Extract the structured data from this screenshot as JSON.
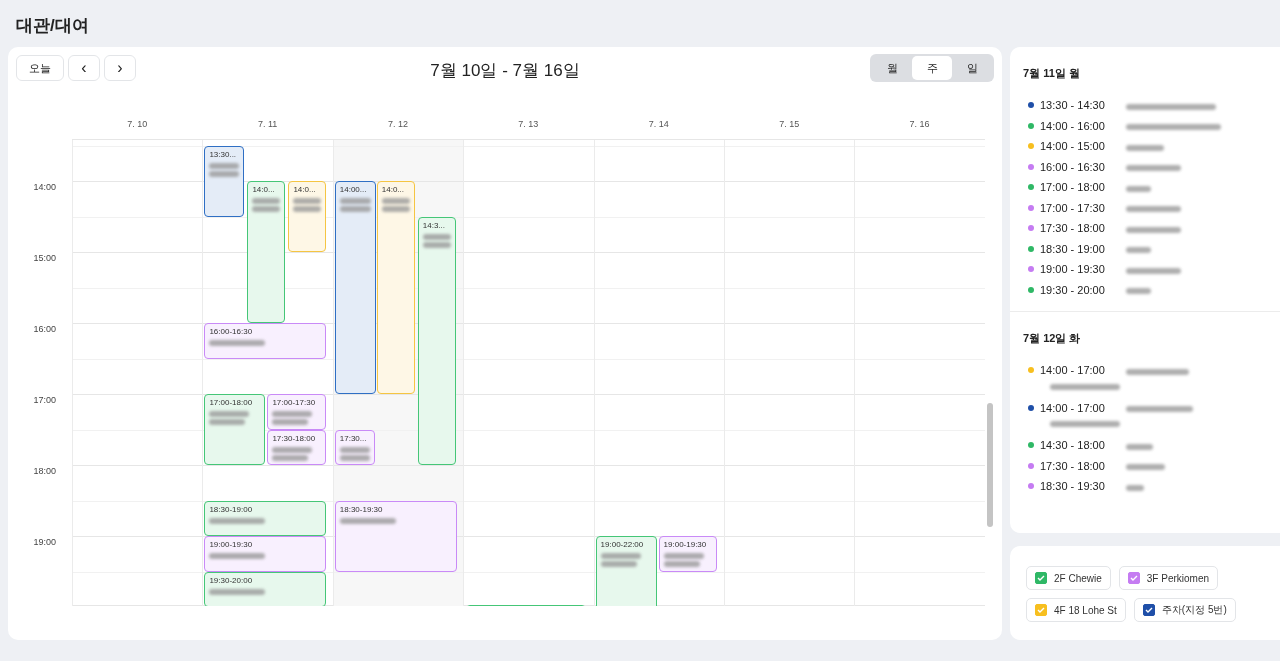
{
  "page": {
    "title": "대관/대여"
  },
  "toolbar": {
    "today": "오늘",
    "prev": "‹",
    "next": "›",
    "range": "7월 10일 - 7월 16일",
    "views": [
      {
        "label": "월",
        "selected": false
      },
      {
        "label": "주",
        "selected": true
      },
      {
        "label": "일",
        "selected": false
      }
    ]
  },
  "hours": [
    "14:00",
    "15:00",
    "16:00",
    "17:00",
    "18:00",
    "19:00"
  ],
  "days": [
    {
      "label": "7. 10",
      "today": false
    },
    {
      "label": "7. 11",
      "today": false,
      "events": [
        {
          "label": "13:30...",
          "color": "#2f6fc4"
        },
        {
          "label": "14:0...",
          "color": "#45c677"
        },
        {
          "label": "14:0...",
          "color": "#f5c542"
        },
        {
          "label": "16:00-16:30",
          "color": "#c98af7"
        },
        {
          "label": "17:00-18:00",
          "color": "#45c677"
        },
        {
          "label": "17:00-17:30",
          "color": "#c98af7"
        },
        {
          "label": "17:30-18:00",
          "color": "#c98af7"
        },
        {
          "label": "18:30-19:00",
          "color": "#45c677"
        },
        {
          "label": "19:00-19:30",
          "color": "#c98af7"
        },
        {
          "label": "19:30-20:00",
          "color": "#45c677"
        }
      ]
    },
    {
      "label": "7. 12",
      "today": true,
      "events": [
        {
          "label": "14:00...",
          "color": "#2f6fc4"
        },
        {
          "label": "14:0...",
          "color": "#f5c542"
        },
        {
          "label": "14:3...",
          "color": "#45c677"
        },
        {
          "label": "17:30...",
          "color": "#c98af7"
        },
        {
          "label": "18:30-19:30",
          "color": "#c98af7"
        }
      ]
    },
    {
      "label": "7. 13",
      "today": false,
      "events": [
        {
          "color": "#45c677"
        }
      ]
    },
    {
      "label": "7. 14",
      "today": false,
      "events": [
        {
          "label": "19:00-22:00",
          "color": "#45c677"
        },
        {
          "label": "19:00-19:30",
          "color": "#c98af7"
        }
      ]
    },
    {
      "label": "7. 15",
      "today": false
    },
    {
      "label": "7. 16",
      "today": false
    }
  ],
  "agenda": [
    {
      "title": "7월 11일 월",
      "items": [
        {
          "time": "13:30 - 14:30",
          "color": "#1f4fa8",
          "has_subline": false
        },
        {
          "time": "14:00 - 16:00",
          "color": "#2fb866",
          "has_subline": false
        },
        {
          "time": "14:00 - 15:00",
          "color": "#f7bf1f",
          "has_subline": false
        },
        {
          "time": "16:00 - 16:30",
          "color": "#c57cf2",
          "has_subline": false
        },
        {
          "time": "17:00 - 18:00",
          "color": "#2fb866",
          "has_subline": false
        },
        {
          "time": "17:00 - 17:30",
          "color": "#c57cf2",
          "has_subline": false
        },
        {
          "time": "17:30 - 18:00",
          "color": "#c57cf2",
          "has_subline": false
        },
        {
          "time": "18:30 - 19:00",
          "color": "#2fb866",
          "has_subline": false
        },
        {
          "time": "19:00 - 19:30",
          "color": "#c57cf2",
          "has_subline": false
        },
        {
          "time": "19:30 - 20:00",
          "color": "#2fb866",
          "has_subline": false
        }
      ]
    },
    {
      "title": "7월 12일 화",
      "items": [
        {
          "time": "14:00 - 17:00",
          "color": "#f7bf1f",
          "has_subline": true
        },
        {
          "time": "14:00 - 17:00",
          "color": "#1f4fa8",
          "has_subline": true
        },
        {
          "time": "14:30 - 18:00",
          "color": "#2fb866",
          "has_subline": false
        },
        {
          "time": "17:30 - 18:00",
          "color": "#c57cf2",
          "has_subline": false
        },
        {
          "time": "18:30 - 19:30",
          "color": "#c57cf2",
          "has_subline": false
        }
      ]
    }
  ],
  "legend": [
    {
      "label": "2F Chewie",
      "color": "#2fb866",
      "checked": true
    },
    {
      "label": "3F Perkiomen",
      "color": "#c57cf2",
      "checked": true
    },
    {
      "label": "4F 18 Lohe St",
      "color": "#f7bf1f",
      "checked": true
    },
    {
      "label": "주차(지정 5번)",
      "color": "#1f4fa8",
      "checked": true
    }
  ]
}
